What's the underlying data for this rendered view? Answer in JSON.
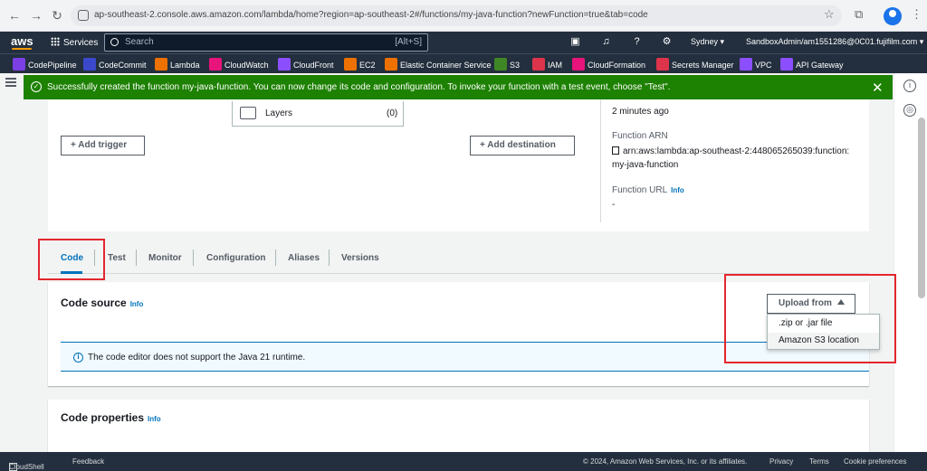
{
  "browser": {
    "url": "ap-southeast-2.console.aws.amazon.com/lambda/home?region=ap-southeast-2#/functions/my-java-function?newFunction=true&tab=code"
  },
  "aws_nav": {
    "services_label": "Services",
    "search_placeholder": "Search",
    "search_hint": "[Alt+S]",
    "region": "Sydney ▾",
    "account": "SandboxAdmin/am1551286@0C01.fujifilm.com ▾"
  },
  "favorites": [
    {
      "label": "CodePipeline",
      "color": "#7b3fe4"
    },
    {
      "label": "CodeCommit",
      "color": "#3b48cc"
    },
    {
      "label": "Lambda",
      "color": "#ed7100"
    },
    {
      "label": "CloudWatch",
      "color": "#e7157b"
    },
    {
      "label": "CloudFront",
      "color": "#8c4fff"
    },
    {
      "label": "EC2",
      "color": "#ed7100"
    },
    {
      "label": "Elastic Container Service",
      "color": "#ed7100"
    },
    {
      "label": "S3",
      "color": "#3f8624"
    },
    {
      "label": "IAM",
      "color": "#dd344c"
    },
    {
      "label": "CloudFormation",
      "color": "#e7157b"
    },
    {
      "label": "Secrets Manager",
      "color": "#dd344c"
    },
    {
      "label": "VPC",
      "color": "#8c4fff"
    },
    {
      "label": "API Gateway",
      "color": "#8c4fff"
    }
  ],
  "flash": {
    "message": "Successfully created the function my-java-function. You can now change its code and configuration. To invoke your function with a test event, choose \"Test\".",
    "color": "#1d8102"
  },
  "overview": {
    "layers_label": "Layers",
    "layers_count": "(0)",
    "add_trigger": "Add trigger",
    "add_destination": "Add destination",
    "last_modified_value": "2 minutes ago",
    "arn_label": "Function ARN",
    "arn_value_line1": "arn:aws:lambda:ap-southeast-2:448065265039:function:",
    "arn_value_line2": "my-java-function",
    "url_label": "Function URL",
    "url_info": "Info",
    "url_value": "-"
  },
  "tabs": [
    "Code",
    "Test",
    "Monitor",
    "Configuration",
    "Aliases",
    "Versions"
  ],
  "code_source": {
    "title": "Code source",
    "info": "Info",
    "upload_label": "Upload from",
    "upload_options": [
      ".zip or .jar file",
      "Amazon S3 location"
    ],
    "alert": "The code editor does not support the Java 21 runtime."
  },
  "code_properties": {
    "title": "Code properties",
    "info": "Info"
  },
  "footer": {
    "cloudshell": "CloudShell",
    "feedback": "Feedback",
    "copyright": "© 2024, Amazon Web Services, Inc. or its affiliates.",
    "privacy": "Privacy",
    "terms": "Terms",
    "cookies": "Cookie preferences"
  }
}
